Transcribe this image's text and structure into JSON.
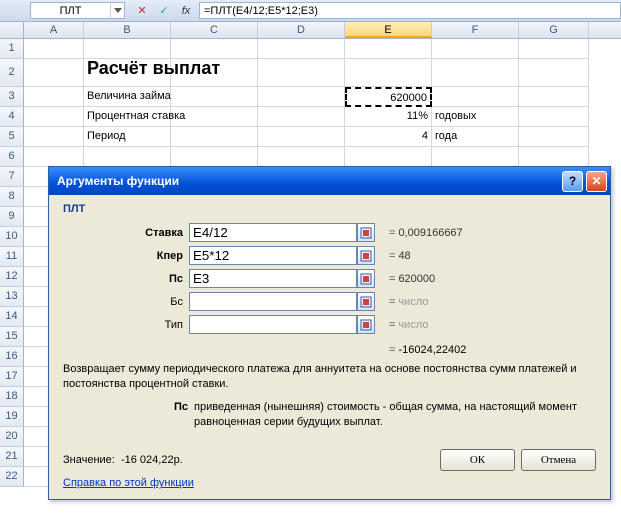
{
  "formula_bar": {
    "name_box": "ПЛТ",
    "cancel_glyph": "✕",
    "accept_glyph": "✓",
    "fx_label": "fx",
    "formula": "=ПЛТ(E4/12;E5*12;E3)"
  },
  "columns": [
    "A",
    "B",
    "C",
    "D",
    "E",
    "F",
    "G"
  ],
  "selected_col": "E",
  "rows": [
    "1",
    "2",
    "3",
    "4",
    "5",
    "6",
    "7",
    "8",
    "9",
    "10",
    "11",
    "12",
    "13",
    "14",
    "15",
    "16",
    "17",
    "18",
    "19",
    "20",
    "21",
    "22"
  ],
  "sheet": {
    "title": "Расчёт выплат",
    "r3_label": "Величина займа",
    "r3_value": "620000",
    "r4_label": "Процентная ставка",
    "r4_value": "11%",
    "r4_unit": "годовых",
    "r5_label": "Период",
    "r5_value": "4",
    "r5_unit": "года"
  },
  "dialog": {
    "title": "Аргументы функции",
    "func_name": "ПЛТ",
    "args": [
      {
        "label": "Ставка",
        "value": "E4/12",
        "result": "0,009166667",
        "bold": true,
        "gray": false
      },
      {
        "label": "Кпер",
        "value": "E5*12",
        "result": "48",
        "bold": true,
        "gray": false
      },
      {
        "label": "Пс",
        "value": "E3",
        "result": "620000",
        "bold": true,
        "gray": false
      },
      {
        "label": "Бс",
        "value": "",
        "result": "число",
        "bold": false,
        "gray": true
      },
      {
        "label": "Тип",
        "value": "",
        "result": "число",
        "bold": false,
        "gray": true
      }
    ],
    "calc_result": "-16024,22402",
    "description": "Возвращает сумму периодического платежа для аннуитета на основе постоянства сумм платежей и постоянства процентной ставки.",
    "param_name": "Пс",
    "param_text": "приведенная (нынешняя) стоимость - общая сумма, на настоящий момент равноценная серии будущих выплат.",
    "value_label": "Значение:",
    "value": "-16 024,22р.",
    "help_link": "Справка по этой функции",
    "ok": "ОК",
    "cancel": "Отмена"
  }
}
